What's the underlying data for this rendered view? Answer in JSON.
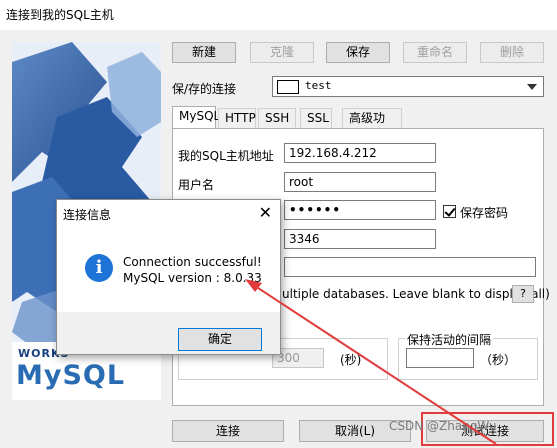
{
  "window": {
    "title": "连接到我的SQL主机"
  },
  "toolbar": {
    "new": "新建",
    "clone": "克隆",
    "save": "保存",
    "rename": "重命名",
    "delete": "删除"
  },
  "saved_conn": {
    "label": "保/存的连接",
    "value": "test"
  },
  "tabs": [
    "MySQL",
    "HTTP",
    "SSH",
    "SSL",
    "高级功能"
  ],
  "form": {
    "host_label": "我的SQL主机地址",
    "host_value": "192.168.4.212",
    "user_label": "用户名",
    "user_value": "root",
    "password_value": "••••••",
    "save_password": "保存密码",
    "port_value": "3346",
    "db_hint": "ultiple databases. Leave blank to display all)",
    "help": "?",
    "timeout_value": "300",
    "timeout_unit": "(秒)",
    "keepalive_label": "保持活动的间隔",
    "keepalive_unit": "（秒）"
  },
  "logo": {
    "top": "WORKS",
    "brand": "MySQL"
  },
  "bottom": {
    "connect": "连接",
    "cancel": "取消(L)",
    "test": "测试连接"
  },
  "dialog": {
    "title": "连接信息",
    "close": "✕",
    "icon": "i",
    "line1": "Connection successful!",
    "line2": "MySQL version : 8.0.33",
    "ok": "确定"
  },
  "watermark": "CSDN @ZhangWu",
  "colors": {
    "accent": "#1d74d6",
    "annotation": "#e23b3b"
  }
}
